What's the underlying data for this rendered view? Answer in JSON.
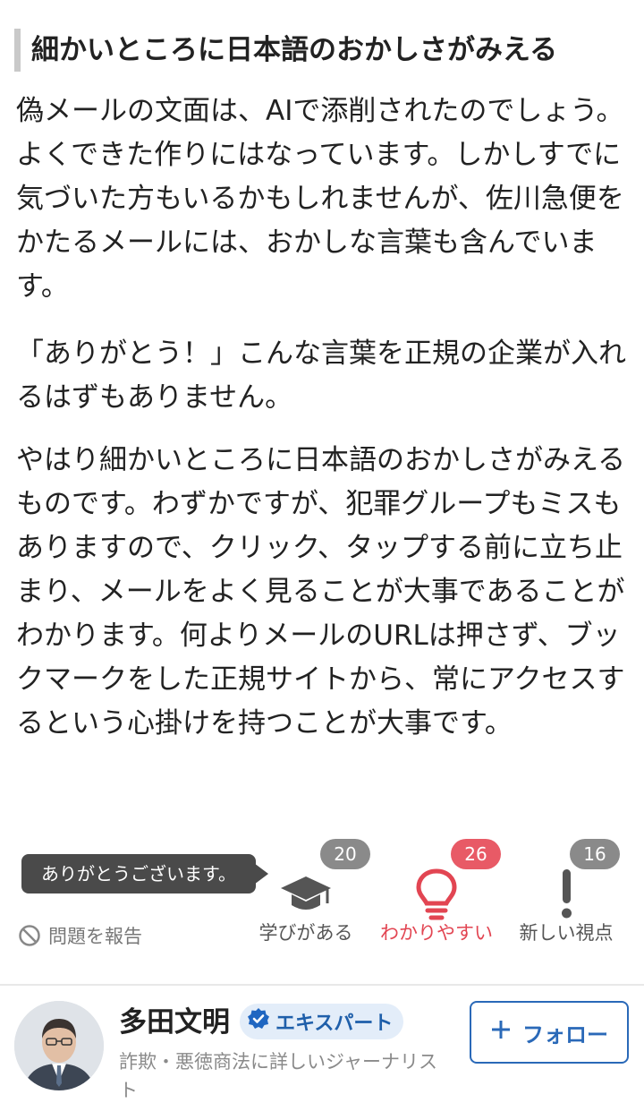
{
  "article": {
    "heading": "細かいところに日本語のおかしさがみえる",
    "paragraphs": [
      "偽メールの文面は、AIで添削されたのでしょう。よくできた作りにはなっています。しかしすでに気づいた方もいるかもしれませんが、佐川急便をかたるメールには、おかしな言葉も含んでいます。",
      "「ありがとう！」こんな言葉を正規の企業が入れるはずもありません。",
      "やはり細かいところに日本語のおかしさがみえるものです。わずかですが、犯罪グループもミスもありますので、クリック、タップする前に立ち止まり、メールをよく見ることが大事であることがわかります。何よりメールのURLは押さず、ブックマークをした正規サイトから、常にアクセスするという心掛けを持つことが大事です。"
    ]
  },
  "reactions": {
    "tooltip": "ありがとうございます。",
    "report_label": "問題を報告",
    "items": [
      {
        "label": "学びがある",
        "count": "20",
        "icon": "graduation-cap-icon",
        "color": "#555555"
      },
      {
        "label": "わかりやすい",
        "count": "26",
        "icon": "lightbulb-icon",
        "color": "#e24552",
        "active": true
      },
      {
        "label": "新しい視点",
        "count": "16",
        "icon": "exclamation-icon",
        "color": "#555555"
      }
    ]
  },
  "author": {
    "name": "多田文明",
    "badge": "エキスパート",
    "description": "詐欺・悪徳商法に詳しいジャーナリスト",
    "follow_label": "フォロー"
  },
  "colors": {
    "accent_blue": "#2a69b8",
    "active_red": "#e24552",
    "text": "#222222"
  }
}
